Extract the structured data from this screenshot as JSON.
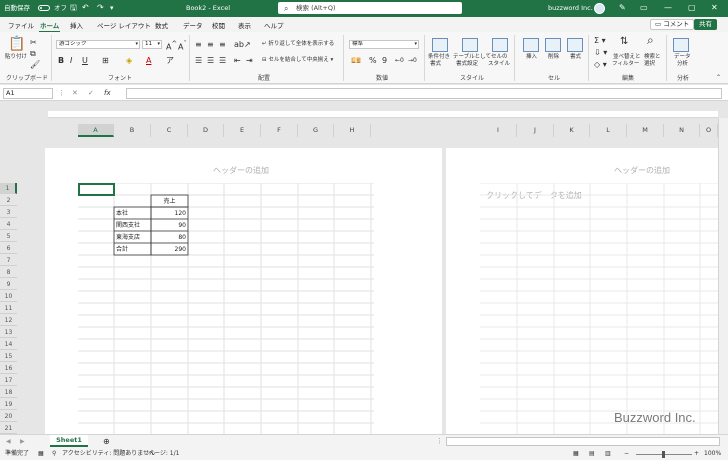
{
  "titlebar": {
    "autosave_label": "自動保存",
    "autosave_state": "オフ",
    "title": "Book2 - Excel",
    "search_placeholder": "検索 (Alt+Q)",
    "user_name": "buzzword Inc."
  },
  "tabs": [
    "ファイル",
    "ホーム",
    "挿入",
    "ページ レイアウト",
    "数式",
    "データ",
    "校閲",
    "表示",
    "ヘルプ"
  ],
  "active_tab": "ホーム",
  "tab_actions": {
    "comments": "コメント",
    "share": "共有"
  },
  "ribbon": {
    "clipboard": {
      "paste": "貼り付け",
      "label": "クリップボード"
    },
    "font": {
      "name": "游ゴシック",
      "size": "11",
      "label": "フォント"
    },
    "alignment": {
      "wrap": "折り返して全体を表示する",
      "merge": "セルを結合して中央揃え",
      "label": "配置"
    },
    "number": {
      "format": "標準",
      "label": "数値"
    },
    "styles": {
      "cond": "条件付き",
      "cond2": "書式",
      "table": "テーブルとして",
      "table2": "書式設定",
      "cell": "セルの",
      "cell2": "スタイル",
      "label": "スタイル"
    },
    "cells": {
      "insert": "挿入",
      "delete": "削除",
      "format": "書式",
      "label": "セル"
    },
    "editing": {
      "sort": "並べ替えと",
      "sort2": "フィルター",
      "find": "検索と",
      "find2": "選択",
      "label": "編集"
    },
    "analysis": {
      "analyze": "データ",
      "analyze2": "分析",
      "label": "分析"
    }
  },
  "formula_bar": {
    "name_box": "A1",
    "fx": "fx",
    "value": ""
  },
  "columns_left": [
    "A",
    "B",
    "C",
    "D",
    "E",
    "F",
    "G",
    "H"
  ],
  "columns_right": [
    "I",
    "J",
    "K",
    "L",
    "M",
    "N",
    "O"
  ],
  "rows": [
    "1",
    "2",
    "3",
    "4",
    "5",
    "6",
    "7",
    "8",
    "9",
    "10",
    "11",
    "12",
    "13",
    "14",
    "15",
    "16",
    "17",
    "18",
    "19",
    "20",
    "21"
  ],
  "page": {
    "header_placeholder": "ヘッダーの追加",
    "click_to_add_data": "クリックしてデータを追加"
  },
  "table": {
    "header": "売上",
    "rows": [
      {
        "label": "本社",
        "value": "120"
      },
      {
        "label": "関西支社",
        "value": "90"
      },
      {
        "label": "東海支店",
        "value": "80"
      },
      {
        "label": "合計",
        "value": "290"
      }
    ]
  },
  "sheet_tabs": [
    "Sheet1"
  ],
  "status": {
    "ready": "準備完了",
    "accessibility": "アクセシビリティ: 問題ありません",
    "page": "ページ: 1/1",
    "zoom": "100%"
  },
  "watermark": "Buzzword Inc.",
  "colors": {
    "accent": "#217346"
  }
}
